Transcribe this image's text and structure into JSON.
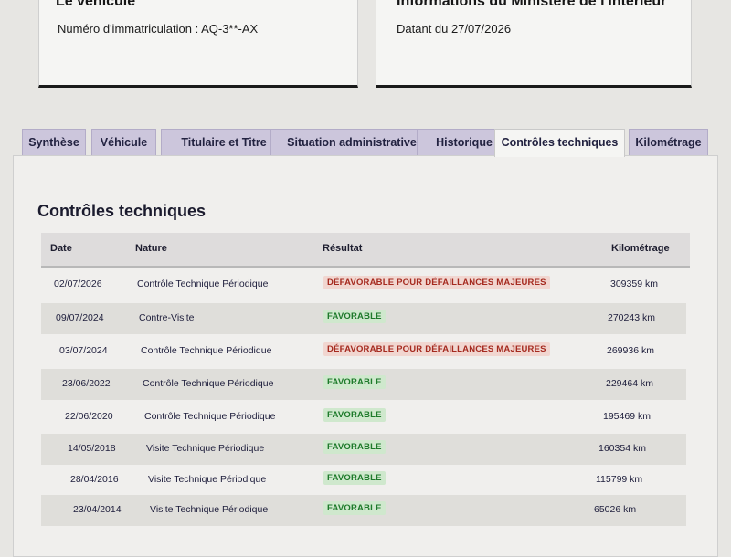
{
  "vehicle_card": {
    "title": "Le véhicule",
    "registration": "Numéro d'immatriculation : AQ-3**-AX"
  },
  "ministry_card": {
    "title": "Informations du Ministère de l'Intérieur",
    "date": "Datant du 27/07/2026"
  },
  "tabs": [
    {
      "label": "Synthèse",
      "active": false
    },
    {
      "label": "Véhicule",
      "active": false
    },
    {
      "label": "Titulaire et Titre",
      "active": false
    },
    {
      "label": "Situation administrative",
      "active": false
    },
    {
      "label": "Historique",
      "active": false
    },
    {
      "label": "Contrôles techniques",
      "active": true
    },
    {
      "label": "Kilométrage",
      "active": false
    }
  ],
  "section_title": "Contrôles techniques",
  "table": {
    "headers": {
      "date": "Date",
      "nature": "Nature",
      "result": "Résultat",
      "mileage": "Kilométrage"
    },
    "rows": [
      {
        "date": "02/07/2026",
        "nature": "Contrôle Technique Périodique",
        "result": "DÉFAVORABLE POUR DÉFAILLANCES MAJEURES",
        "status": "bad",
        "mileage": "309359 km"
      },
      {
        "date": "09/07/2024",
        "nature": "Contre-Visite",
        "result": "FAVORABLE",
        "status": "good",
        "mileage": "270243 km"
      },
      {
        "date": "03/07/2024",
        "nature": "Contrôle Technique Périodique",
        "result": "DÉFAVORABLE POUR DÉFAILLANCES MAJEURES",
        "status": "bad",
        "mileage": "269936 km"
      },
      {
        "date": "23/06/2022",
        "nature": "Contrôle Technique Périodique",
        "result": "FAVORABLE",
        "status": "good",
        "mileage": "229464 km"
      },
      {
        "date": "22/06/2020",
        "nature": "Contrôle Technique Périodique",
        "result": "FAVORABLE",
        "status": "good",
        "mileage": "195469 km"
      },
      {
        "date": "14/05/2018",
        "nature": "Visite Technique Périodique",
        "result": "FAVORABLE",
        "status": "good",
        "mileage": "160354 km"
      },
      {
        "date": "28/04/2016",
        "nature": "Visite Technique Périodique",
        "result": "FAVORABLE",
        "status": "good",
        "mileage": "115799 km"
      },
      {
        "date": "23/04/2014",
        "nature": "Visite Technique Périodique",
        "result": "FAVORABLE",
        "status": "good",
        "mileage": "65026 km"
      }
    ]
  },
  "colors": {
    "tab_inactive": "#ccc6dc",
    "unfavorable_text": "#a52a1f",
    "unfavorable_bg": "#f1d6d0",
    "favorable_text": "#1d7a2a",
    "favorable_bg": "#cfe8cd"
  }
}
